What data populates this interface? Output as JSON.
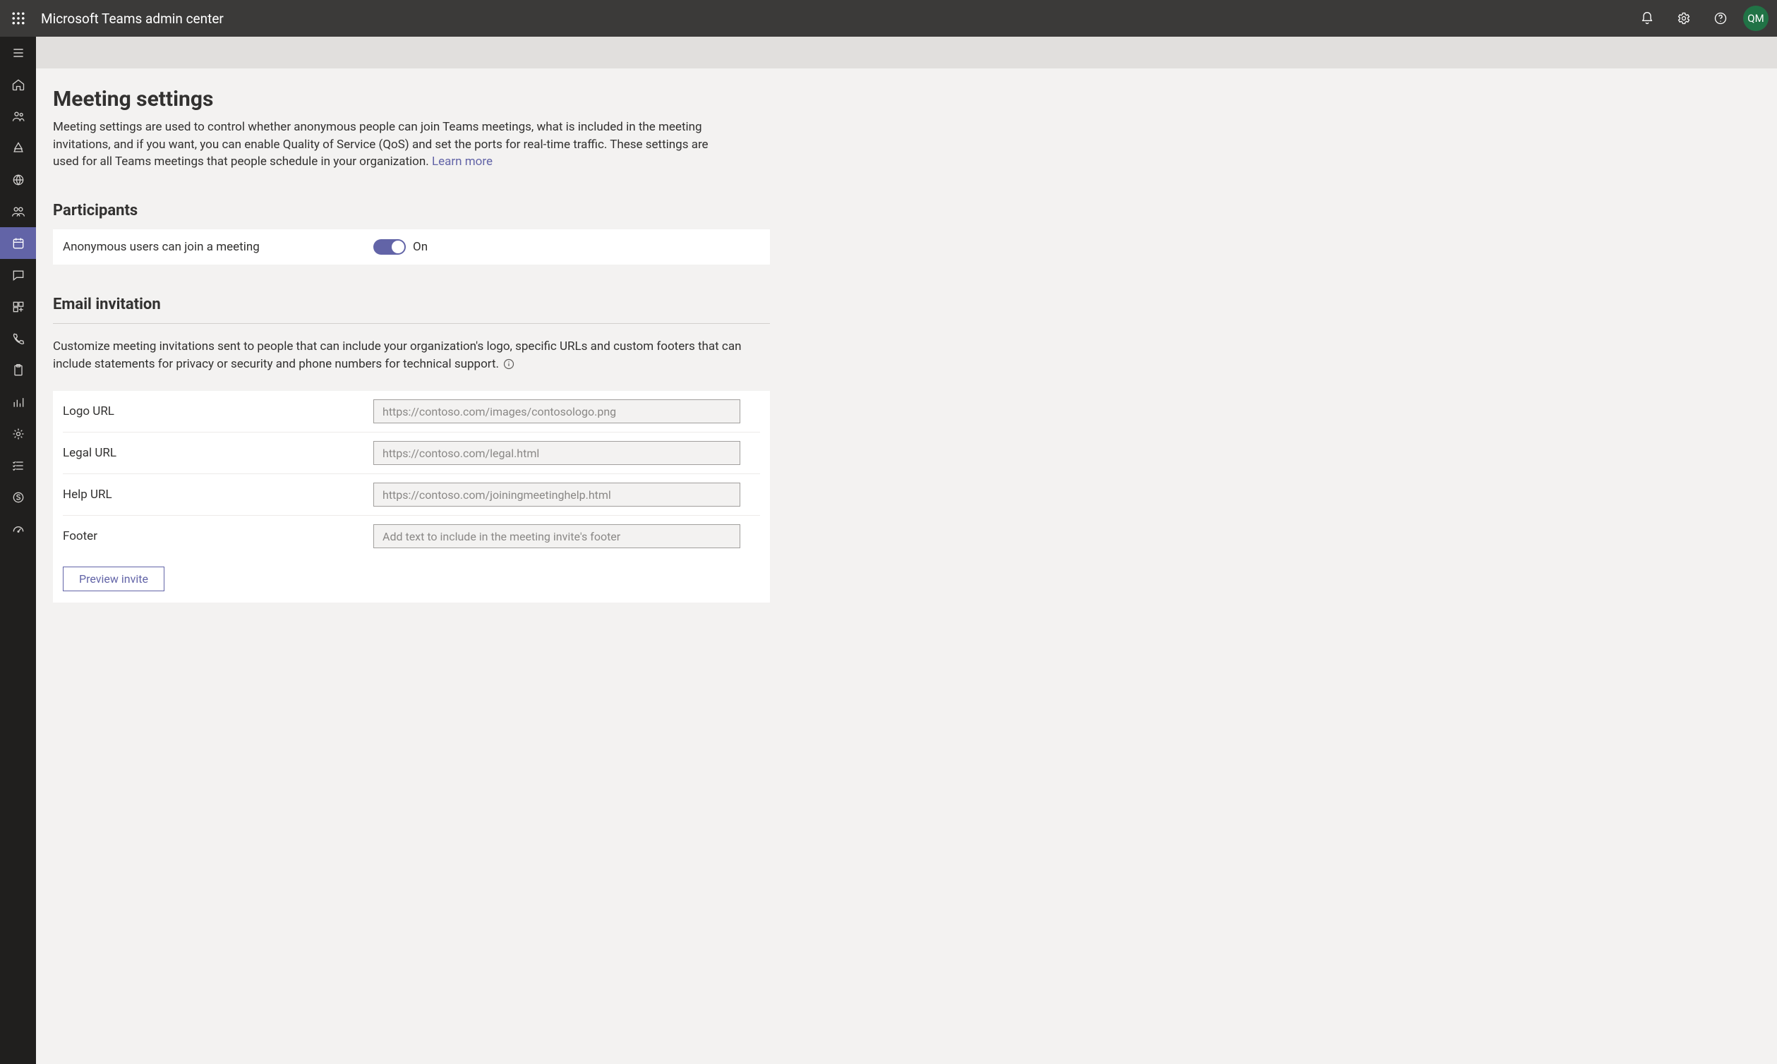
{
  "header": {
    "app_title": "Microsoft Teams admin center",
    "avatar_initials": "QM"
  },
  "page": {
    "title": "Meeting settings",
    "description": "Meeting settings are used to control whether anonymous people can join Teams meetings, what is included in the meeting invitations, and if you want, you can enable Quality of Service (QoS) and set the ports for real-time traffic. These settings are used for all Teams meetings that people schedule in your organization. ",
    "learn_more": "Learn more"
  },
  "participants": {
    "section_title": "Participants",
    "anonymous_label": "Anonymous users can join a meeting",
    "anonymous_state": "On"
  },
  "email": {
    "section_title": "Email invitation",
    "description": "Customize meeting invitations sent to people that can include your organization's logo, specific URLs and custom footers that can include statements for privacy or security and phone numbers for technical support.",
    "fields": {
      "logo": {
        "label": "Logo URL",
        "placeholder": "https://contoso.com/images/contosologo.png",
        "value": ""
      },
      "legal": {
        "label": "Legal URL",
        "placeholder": "https://contoso.com/legal.html",
        "value": ""
      },
      "help": {
        "label": "Help URL",
        "placeholder": "https://contoso.com/joiningmeetinghelp.html",
        "value": ""
      },
      "footer": {
        "label": "Footer",
        "placeholder": "Add text to include in the meeting invite's footer",
        "value": ""
      }
    },
    "preview_button": "Preview invite"
  },
  "leftrail": {
    "items": [
      "menu",
      "home",
      "teams",
      "devices",
      "locations",
      "users",
      "meetings",
      "messaging",
      "apps",
      "voice",
      "policy",
      "analytics",
      "settings",
      "planning",
      "legacy",
      "health"
    ]
  }
}
